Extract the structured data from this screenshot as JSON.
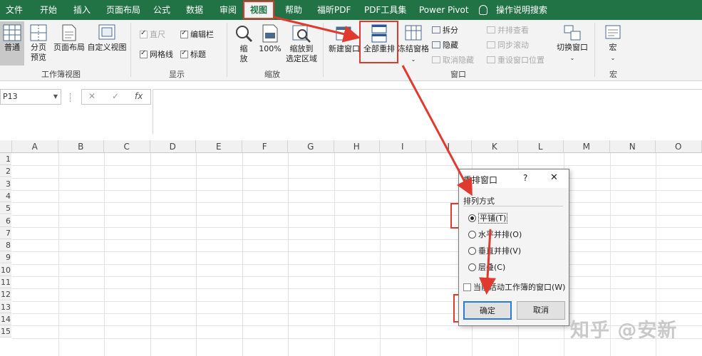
{
  "menu": {
    "tabs": [
      "文件",
      "开始",
      "插入",
      "页面布局",
      "公式",
      "数据",
      "审阅",
      "视图",
      "帮助",
      "福昕PDF",
      "PDF工具集",
      "Power Pivot",
      "操作说明搜索"
    ],
    "active_tab": "视图"
  },
  "ribbon": {
    "workbook_views": {
      "normal": "普通",
      "page_break_1": "分页",
      "page_break_2": "预览",
      "page_layout": "页面布局",
      "custom_views": "自定义视图",
      "group": "工作簿视图"
    },
    "show": {
      "ruler": "直尺",
      "formula_bar": "编辑栏",
      "gridlines": "网格线",
      "headings": "标题",
      "group": "显示"
    },
    "zoom": {
      "zoom_1": "缩",
      "zoom_2": "放",
      "hundred": "100%",
      "selection_1": "缩放到",
      "selection_2": "选定区域",
      "group": "缩放"
    },
    "window": {
      "new_window": "新建窗口",
      "arrange_all": "全部重排",
      "freeze_panes": "冻结窗格",
      "split": "拆分",
      "hide": "隐藏",
      "unhide": "取消隐藏",
      "side_by_side": "并排查看",
      "sync_scroll": "同步滚动",
      "reset_position": "重设窗口位置",
      "switch_windows": "切换窗口",
      "group": "窗口"
    },
    "macros": {
      "macro": "宏",
      "group": "宏"
    }
  },
  "formula_bar": {
    "cell_ref": "P13",
    "cancel": "✕",
    "enter": "✓",
    "fx": "fx"
  },
  "sheet": {
    "columns": [
      "A",
      "B",
      "C",
      "D",
      "E",
      "F",
      "G",
      "H",
      "I",
      "J",
      "K",
      "L",
      "M",
      "N",
      "O"
    ],
    "rows": [
      "1",
      "2",
      "3",
      "4",
      "5",
      "6",
      "7",
      "8",
      "9",
      "10",
      "11",
      "12",
      "13",
      "14",
      "15"
    ]
  },
  "dialog": {
    "title": "重排窗口",
    "help": "?",
    "close": "✕",
    "section": "排列方式",
    "options": [
      "平铺(T)",
      "水平并排(O)",
      "垂直并排(V)",
      "层叠(C)"
    ],
    "selected": "平铺(T)",
    "checkbox": "当前活动工作簿的窗口(W)",
    "ok": "确定",
    "cancel": "取消"
  },
  "watermark": "知乎 @安新",
  "colors": {
    "title_bar": "#217346",
    "annotation": "#e03a2f"
  }
}
